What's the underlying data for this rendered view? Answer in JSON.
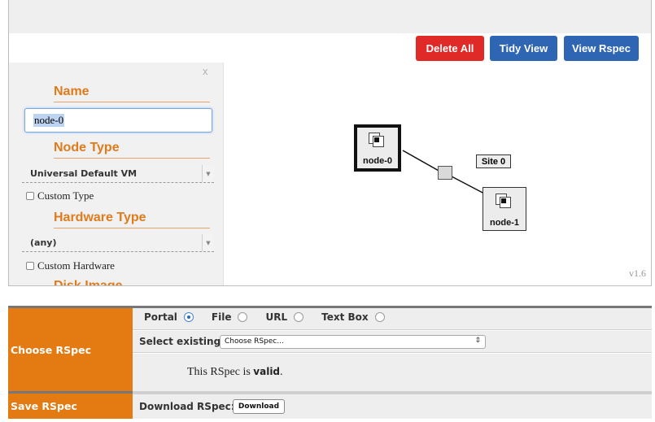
{
  "toolbar": {
    "delete_all": "Delete All",
    "tidy_view": "Tidy View",
    "view_rspec": "View Rspec"
  },
  "side_panel": {
    "close": "x",
    "name_title": "Name",
    "name_value": "node-0",
    "node_type_title": "Node Type",
    "node_type_value": "Universal Default VM",
    "custom_type": "Custom Type",
    "hardware_type_title": "Hardware Type",
    "hardware_value": "(any)",
    "custom_hardware": "Custom Hardware",
    "disk_image_title": "Disk Image"
  },
  "topology": {
    "nodes": [
      "node-0",
      "node-1"
    ],
    "site_label": "Site 0",
    "version": "v1.6"
  },
  "form": {
    "choose_label": "Choose RSpec",
    "save_label": "Save RSpec",
    "sources": [
      {
        "label": "Portal",
        "selected": true
      },
      {
        "label": "File",
        "selected": false
      },
      {
        "label": "URL",
        "selected": false
      },
      {
        "label": "Text Box",
        "selected": false
      }
    ],
    "select_existing_label": "Select existing:",
    "select_existing_value": "Choose RSpec...",
    "valid_prefix": "This RSpec is",
    "valid_word": "valid",
    "valid_suffix": ".",
    "download_label": "Download RSpec:",
    "download_button": "Download"
  },
  "colors": {
    "delete": "#e02a27",
    "primary": "#2e66b4",
    "accent_orange": "#e37a12"
  }
}
